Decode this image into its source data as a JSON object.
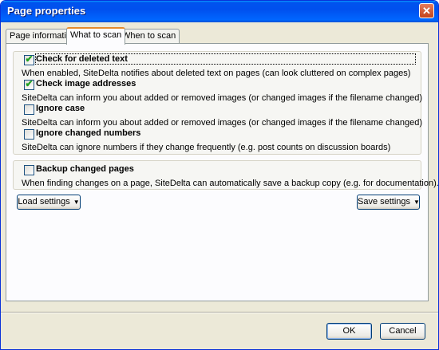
{
  "window": {
    "title": "Page properties",
    "close_symbol": "✕"
  },
  "tabs": [
    {
      "label": "Page information",
      "active": false
    },
    {
      "label": "What to scan",
      "active": true
    },
    {
      "label": "When to scan",
      "active": false
    }
  ],
  "scan_options": [
    {
      "label": "Check for deleted text",
      "checked": true,
      "description": "When enabled, SiteDelta notifies about deleted text on pages (can look cluttered on complex pages)"
    },
    {
      "label": "Check image addresses",
      "checked": true,
      "description": "SiteDelta can inform you about added or removed images (or changed images if the filename changed)"
    },
    {
      "label": "Ignore case",
      "checked": false,
      "description": "SiteDelta can inform you about added or removed images (or changed images if the filename changed)"
    },
    {
      "label": "Ignore changed numbers",
      "checked": false,
      "description": "SiteDelta can ignore numbers if they change frequently (e.g. post counts on discussion boards)"
    }
  ],
  "backup": {
    "label": "Backup changed pages",
    "checked": false,
    "description": "When finding changes on a page, SiteDelta can automatically save a backup copy (e.g. for documentation)."
  },
  "buttons": {
    "load": "Load settings",
    "save": "Save settings",
    "ok": "OK",
    "cancel": "Cancel",
    "dropdown_arrow": "▼"
  },
  "check_mark": "✔",
  "colors": {
    "titlebar": "#0054e3",
    "checkmark": "#21a121",
    "active_tab_accent": "#e68b2c"
  }
}
